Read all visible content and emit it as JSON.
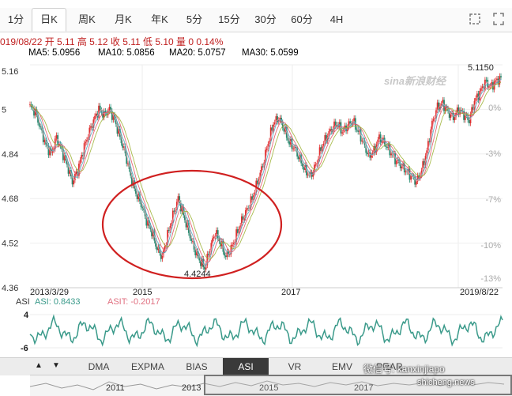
{
  "tabs": [
    {
      "label": "1分"
    },
    {
      "label": "日K"
    },
    {
      "label": "周K"
    },
    {
      "label": "月K"
    },
    {
      "label": "年K"
    },
    {
      "label": "5分"
    },
    {
      "label": "15分"
    },
    {
      "label": "30分"
    },
    {
      "label": "60分"
    },
    {
      "label": "4H"
    }
  ],
  "active_tab": "日K",
  "info_line": "019/08/22 开 5.11 高 5.12 收 5.11 低 5.10 量 0 0.14%",
  "ma": [
    {
      "label": "MA5: 5.0956",
      "color": "#e8a0b0"
    },
    {
      "label": "MA10: 5.0856",
      "color": "#4aa8c0"
    },
    {
      "label": "MA20: 5.0757",
      "color": "#e05060"
    },
    {
      "label": "MA30: 5.0599",
      "color": "#9ab030"
    }
  ],
  "watermark_logo": "sina新浪财经",
  "colors": {
    "up": "#e03030",
    "down": "#2a8a70",
    "circle": "#d02020",
    "asi": "#3a9a8a",
    "asit": "#e07080"
  },
  "chart_data": {
    "type": "line",
    "y_ticks": [
      "5.16",
      "5",
      "4.84",
      "4.68",
      "4.52",
      "4.36"
    ],
    "pct_ticks": [
      "0%",
      "-3%",
      "-7%",
      "-10%",
      "-13%"
    ],
    "x_labels": [
      "2013/3/29",
      "2015",
      "2017",
      "2019/8/22"
    ],
    "ylim": [
      4.36,
      5.16
    ],
    "high_label": "5.1150",
    "low_label": "4.4244",
    "annotation": "circle around 2015 low",
    "price_series": [
      5.01,
      4.99,
      4.93,
      4.87,
      4.84,
      4.9,
      4.85,
      4.8,
      4.74,
      4.78,
      4.85,
      4.91,
      4.96,
      5.0,
      4.98,
      5.0,
      4.96,
      4.9,
      4.84,
      4.76,
      4.7,
      4.66,
      4.6,
      4.56,
      4.5,
      4.47,
      4.55,
      4.62,
      4.68,
      4.62,
      4.56,
      4.5,
      4.46,
      4.43,
      4.5,
      4.56,
      4.52,
      4.47,
      4.5,
      4.55,
      4.6,
      4.64,
      4.68,
      4.74,
      4.8,
      4.88,
      4.95,
      4.97,
      4.93,
      4.88,
      4.86,
      4.82,
      4.78,
      4.76,
      4.8,
      4.86,
      4.9,
      4.93,
      4.95,
      4.92,
      4.94,
      4.96,
      4.92,
      4.88,
      4.83,
      4.85,
      4.9,
      4.88,
      4.85,
      4.82,
      4.8,
      4.78,
      4.76,
      4.74,
      4.78,
      4.85,
      4.95,
      5.01,
      5.02,
      4.99,
      4.97,
      5.0,
      4.98,
      4.96,
      5.03,
      5.06,
      5.1,
      5.08,
      5.1,
      5.115
    ],
    "asi_label": "ASI: 0.8433",
    "asit_label": "ASIT: -0.2017",
    "asi_ticks": [
      "4",
      "-6"
    ]
  },
  "indicator_tabs": [
    {
      "label": "DMA"
    },
    {
      "label": "EXPMA"
    },
    {
      "label": "BIAS"
    },
    {
      "label": "ASI"
    },
    {
      "label": "VR"
    },
    {
      "label": "EMV"
    },
    {
      "label": "PRAR"
    }
  ],
  "active_indicator": "ASI",
  "nav_years": [
    "2011",
    "2013",
    "2015",
    "2017"
  ],
  "watermark_text": "微信号: kanxinjiapo",
  "watermark_site": "shicheng.news"
}
